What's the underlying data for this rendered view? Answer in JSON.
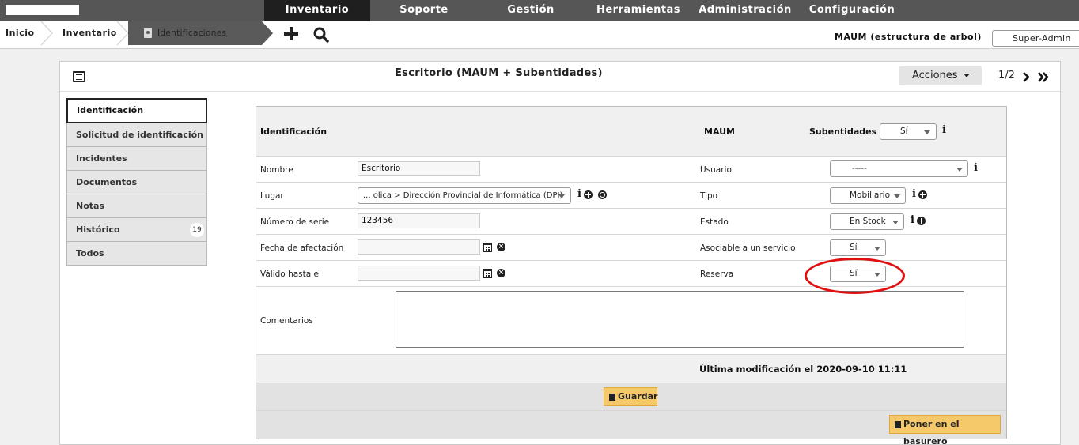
{
  "topnav": {
    "items": [
      {
        "label": "Inventario",
        "active": true
      },
      {
        "label": "Soporte"
      },
      {
        "label": "Gestión"
      },
      {
        "label": "Herramientas"
      },
      {
        "label": "Administración"
      },
      {
        "label": "Configuración"
      }
    ]
  },
  "breadcrumb": {
    "home": "Inicio",
    "section": "Inventario",
    "current": "Identificaciones"
  },
  "header": {
    "entity": "MAUM (estructura de arbol)",
    "profile": "Super-Admin"
  },
  "panel": {
    "title": "Escritorio (MAUM + Subentidades)",
    "actions_label": "Acciones",
    "pager": "1/2"
  },
  "tabs": [
    {
      "label": "Identificación",
      "active": true
    },
    {
      "label": "Solicitud de identificación"
    },
    {
      "label": "Incidentes"
    },
    {
      "label": "Documentos"
    },
    {
      "label": "Notas"
    },
    {
      "label": "Histórico",
      "badge": "19"
    },
    {
      "label": "Todos"
    }
  ],
  "form": {
    "header": {
      "section": "Identificación",
      "entity": "MAUM",
      "subentities_label": "Subentidades",
      "subentities_value": "Sí"
    },
    "fields": {
      "nombre": {
        "label": "Nombre",
        "value": "Escritorio"
      },
      "lugar": {
        "label": "Lugar",
        "value": "... olica > Dirección Provincial de Informática (DPI)"
      },
      "serie": {
        "label": "Número de serie",
        "value": "123456"
      },
      "afectacion": {
        "label": "Fecha de afectación",
        "value": ""
      },
      "valido": {
        "label": "Válido hasta el",
        "value": ""
      },
      "comentarios": {
        "label": "Comentarios",
        "value": ""
      },
      "usuario": {
        "label": "Usuario",
        "value": "-----"
      },
      "tipo": {
        "label": "Tipo",
        "value": "Mobiliario"
      },
      "estado": {
        "label": "Estado",
        "value": "En Stock"
      },
      "asociable": {
        "label": "Asociable a un servicio",
        "value": "Sí"
      },
      "reserva": {
        "label": "Reserva",
        "value": "Sí"
      }
    },
    "last_modified": "Última modificación el 2020-09-10 11:11",
    "save_label": "Guardar",
    "trash_label": "Poner en el basurero"
  },
  "colors": {
    "topbar": "#565656",
    "active_menu": "#1f1f1f",
    "button_yellow": "#f5c86a",
    "highlight": "#e01010"
  }
}
